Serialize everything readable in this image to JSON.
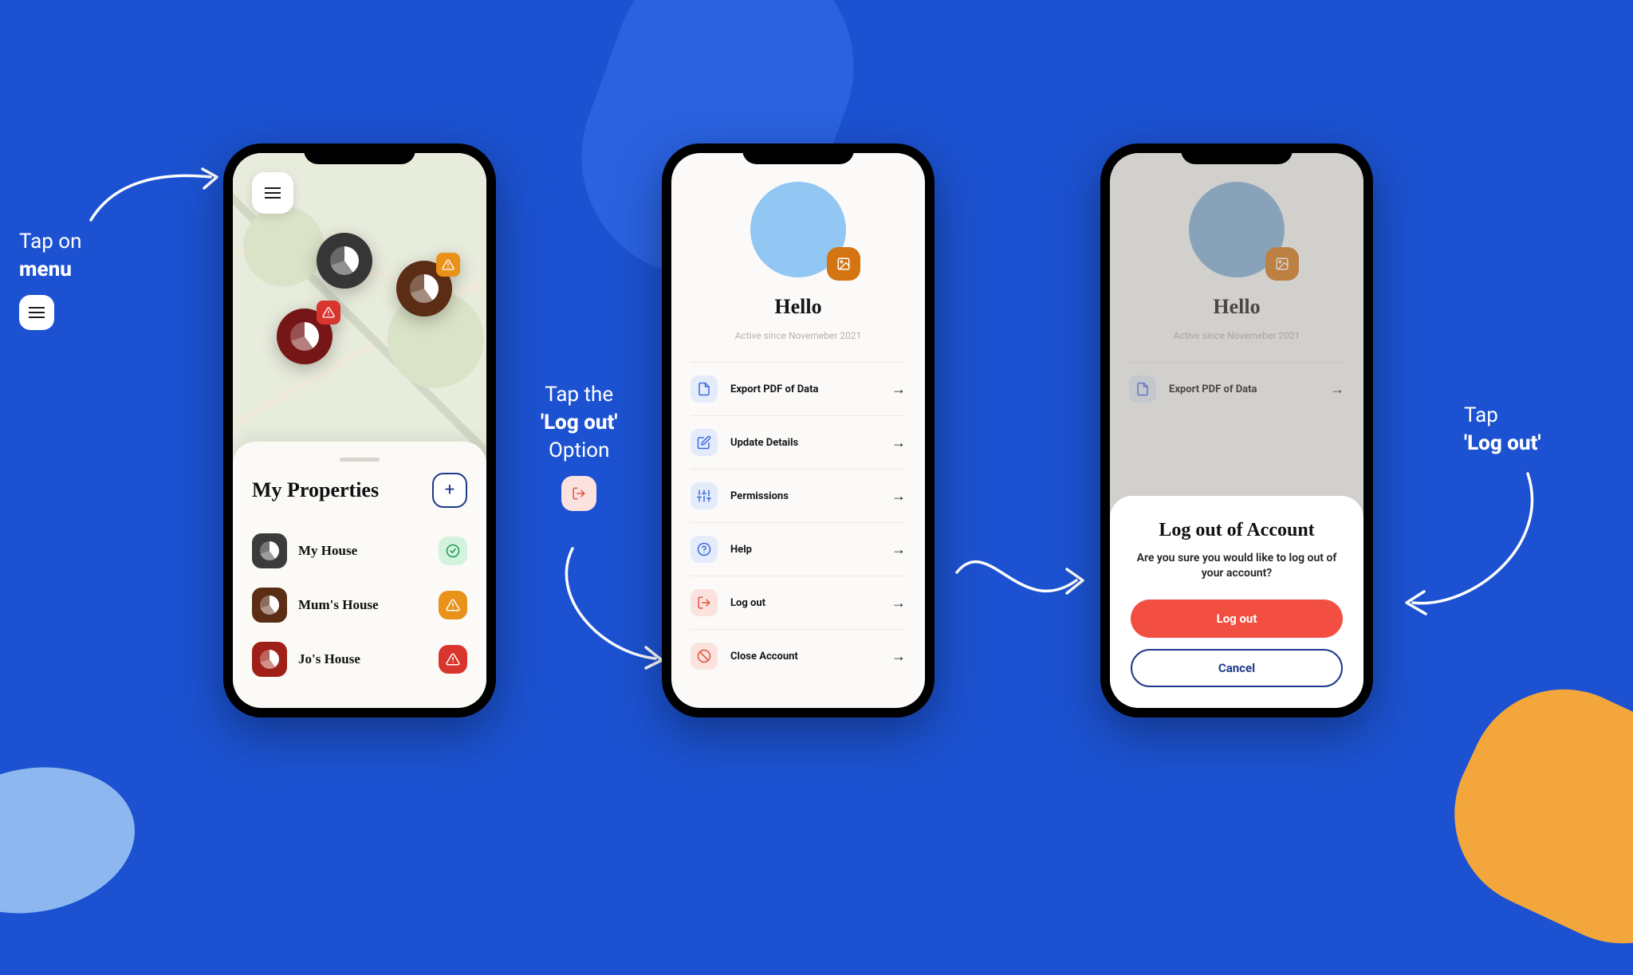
{
  "annotations": {
    "a1_line1": "Tap on",
    "a1_line2": "menu",
    "a2_line1": "Tap the",
    "a2_line2": "'Log out'",
    "a2_line3": "Option",
    "a3_line1": "Tap",
    "a3_line2": "'Log out'"
  },
  "phone1": {
    "section_title": "My Properties",
    "properties": [
      {
        "name": "My House",
        "icon_bg": "#3b3b3b",
        "status": "ok"
      },
      {
        "name": "Mum's House",
        "icon_bg": "#5a2d14",
        "status": "warn"
      },
      {
        "name": "Jo's House",
        "icon_bg": "#a02019",
        "status": "alert"
      }
    ]
  },
  "profile": {
    "greeting": "Hello",
    "active_since": "Active since Novemeber 2021",
    "options": [
      {
        "label": "Export PDF of Data",
        "icon": "pdf",
        "tint": "blue"
      },
      {
        "label": "Update Details",
        "icon": "edit",
        "tint": "blue"
      },
      {
        "label": "Permissions",
        "icon": "sliders",
        "tint": "blue"
      },
      {
        "label": "Help",
        "icon": "help",
        "tint": "blue"
      },
      {
        "label": "Log out",
        "icon": "logout",
        "tint": "red"
      },
      {
        "label": "Close Account",
        "icon": "block",
        "tint": "red"
      }
    ]
  },
  "modal": {
    "title": "Log out of Account",
    "message": "Are you sure you would like to log out of your account?",
    "primary": "Log out",
    "secondary": "Cancel"
  }
}
